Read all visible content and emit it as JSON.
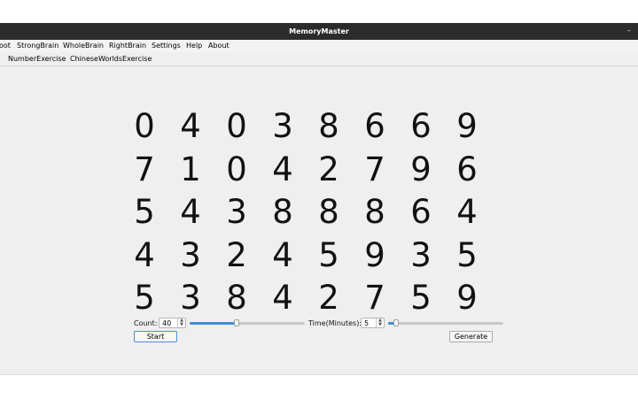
{
  "window": {
    "title": "MemoryMaster",
    "minimize_symbol": "–"
  },
  "menubar": {
    "items": [
      "oot",
      "StrongBrain",
      "WholeBrain",
      "RightBrain",
      "Settings",
      "Help",
      "About"
    ]
  },
  "tabs": {
    "items": [
      "NumberExercise",
      "ChineseWorldsExercise"
    ]
  },
  "digits": [
    [
      "0",
      "4",
      "0",
      "3",
      "8",
      "6",
      "6",
      "9"
    ],
    [
      "7",
      "1",
      "0",
      "4",
      "2",
      "7",
      "9",
      "6"
    ],
    [
      "5",
      "4",
      "3",
      "8",
      "8",
      "8",
      "6",
      "4"
    ],
    [
      "4",
      "3",
      "2",
      "4",
      "5",
      "9",
      "3",
      "5"
    ],
    [
      "5",
      "3",
      "8",
      "4",
      "2",
      "7",
      "5",
      "9"
    ]
  ],
  "controls": {
    "count_label": "Count:",
    "count_value": "40",
    "count_slider_fraction": 0.41,
    "time_label": "Time(Minutes):",
    "time_value": "5",
    "time_slider_fraction": 0.07,
    "start_label": "Start",
    "generate_label": "Generate",
    "accent_color": "#3c8ee0"
  }
}
